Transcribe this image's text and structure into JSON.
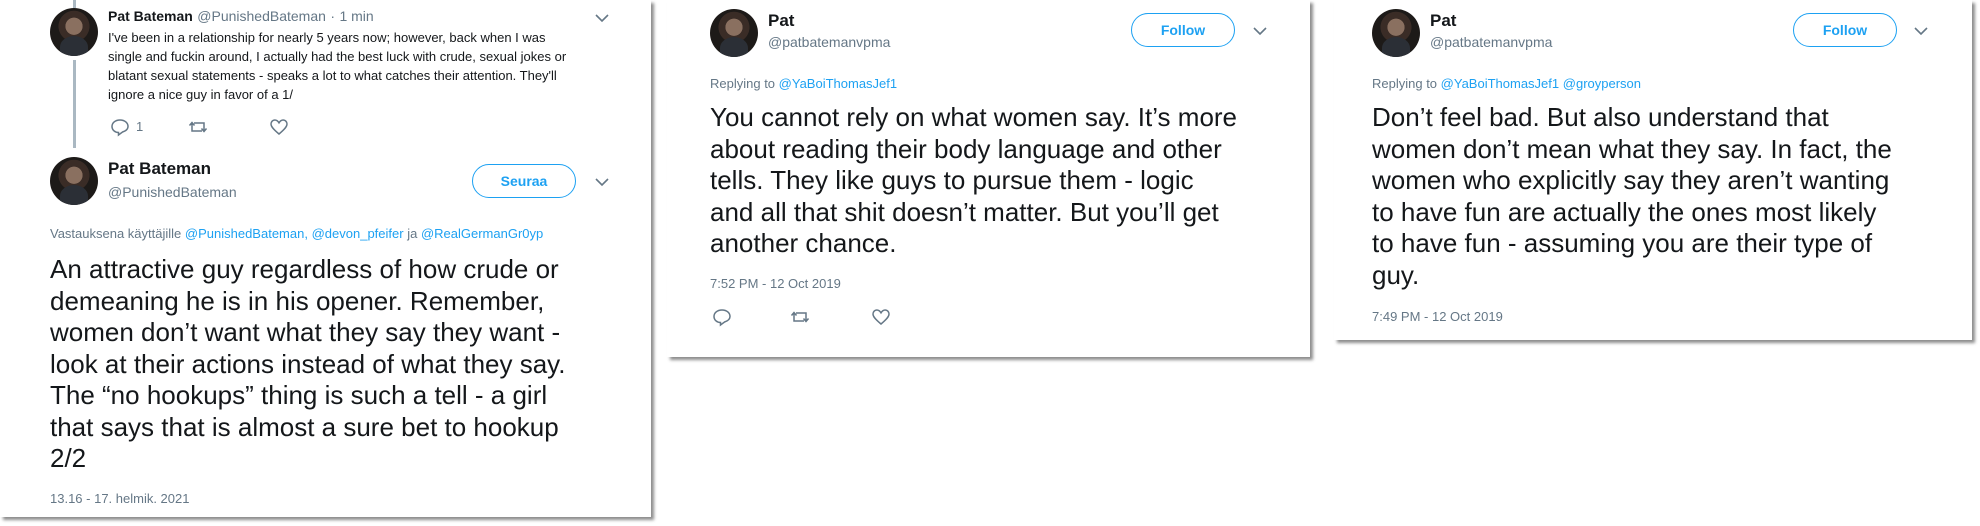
{
  "card1": {
    "tweet1": {
      "name": "Pat Bateman",
      "handle": "@PunishedBateman",
      "dot": "·",
      "time_ago": "1 min",
      "lines": [
        "I've been in a relationship for nearly 5 years now; however, back when I was",
        "single and fuckin around, I actually had the best luck with crude, sexual jokes or",
        "blatant sexual statements - speaks a lot to what catches their attention. They'll",
        "ignore a nice guy in favor of a 1/"
      ],
      "reply_count": "1"
    },
    "tweet2": {
      "name": "Pat Bateman",
      "handle": "@PunishedBateman",
      "follow_label": "Seuraa",
      "reply_prefix": "Vastauksena käyttäjille",
      "reply_users": [
        "@PunishedBateman,",
        "@devon_pfeifer"
      ],
      "reply_and": "ja",
      "reply_last": "@RealGermanGr0yp",
      "lines": [
        "An attractive guy regardless of how crude or",
        "demeaning he is in his opener. Remember,",
        "women don’t want what they say they want -",
        "look at their actions instead of what they say.",
        "The “no hookups” thing is such a tell - a girl",
        "that says that is almost a sure bet to hookup",
        "2/2"
      ],
      "timestamp": "13.16 - 17. helmik. 2021"
    }
  },
  "card2": {
    "name": "Pat",
    "handle": "@patbatemanvpma",
    "follow_label": "Follow",
    "reply_prefix": "Replying to",
    "reply_user": "@YaBoiThomasJef1",
    "lines": [
      "You cannot rely on what women say. It’s more",
      "about reading their body language and other",
      "tells. They like guys to pursue them - logic",
      "and all that shit doesn’t matter. But you’ll get",
      "another chance."
    ],
    "timestamp": "7:52 PM - 12 Oct 2019"
  },
  "card3": {
    "name": "Pat",
    "handle": "@patbatemanvpma",
    "follow_label": "Follow",
    "reply_prefix": "Replying to",
    "reply_user": "@YaBoiThomasJef1",
    "reply_user2": "@groyperson",
    "lines": [
      "Don’t feel bad. But also understand that",
      "women don’t mean what they say. In fact, the",
      "women who explicitly say they aren’t wanting",
      "to have fun are actually the ones most likely",
      "to have fun - assuming you are their type of",
      "guy."
    ],
    "timestamp": "7:49 PM - 12 Oct 2019"
  },
  "colors": {
    "accent": "#1da1f2",
    "muted": "#657786",
    "text": "#14171a"
  },
  "icons": [
    "reply-icon",
    "retweet-icon",
    "like-icon",
    "chevron-down-icon",
    "avatar"
  ]
}
